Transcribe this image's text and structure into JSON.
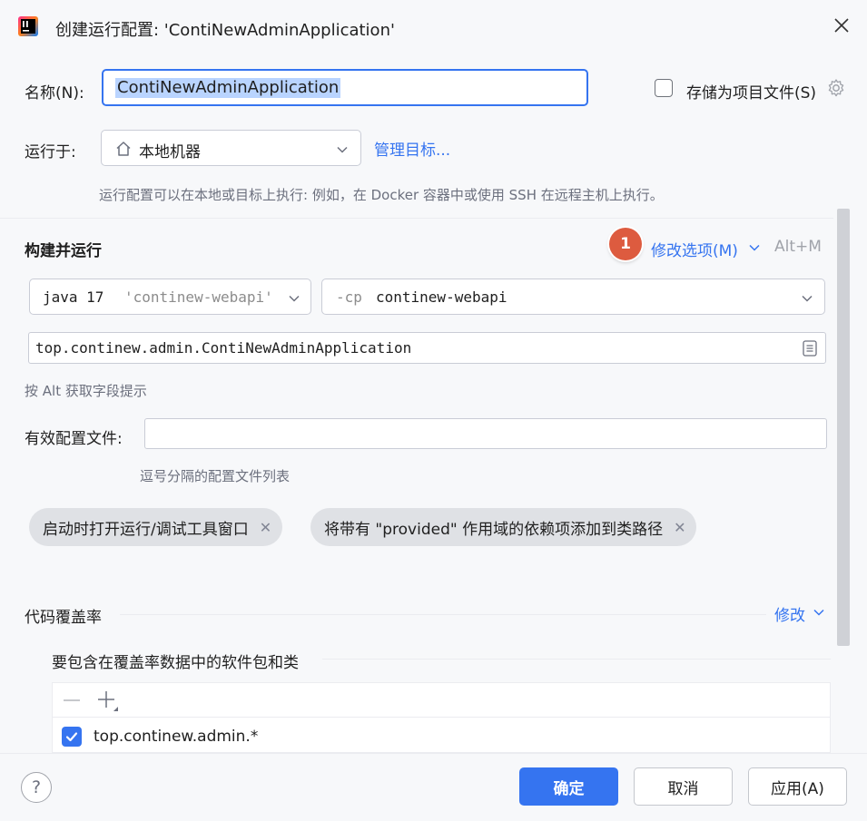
{
  "window": {
    "title": "创建运行配置: 'ContiNewAdminApplication'"
  },
  "form": {
    "name_label": "名称(N):",
    "name_value": "ContiNewAdminApplication",
    "store_as_project_label": "存储为项目文件(S)",
    "store_as_project_checked": false,
    "run_on_label": "运行于:",
    "run_on_value": "本地机器",
    "manage_targets_link": "管理目标...",
    "run_on_hint": "运行配置可以在本地或目标上执行: 例如，在 Docker 容器中或使用 SSH 在远程主机上执行。"
  },
  "build_run": {
    "section_title": "构建并运行",
    "badge_number": "1",
    "modify_options_label": "修改选项(M)",
    "modify_options_shortcut": "Alt+M",
    "jdk_version": "java 17",
    "jdk_module": "'continew-webapi'",
    "cp_flag": "-cp",
    "cp_module": "continew-webapi",
    "main_class": "top.continew.admin.ContiNewAdminApplication",
    "field_hint": "按 Alt 获取字段提示",
    "active_profiles_label": "有效配置文件:",
    "active_profiles_value": "",
    "active_profiles_hint": "逗号分隔的配置文件列表",
    "chips": [
      {
        "label": "启动时打开运行/调试工具窗口"
      },
      {
        "label": "将带有 \"provided\" 作用域的依赖项添加到类路径"
      }
    ]
  },
  "coverage": {
    "section_title": "代码覆盖率",
    "modify_label": "修改",
    "include_label": "要包含在覆盖率数据中的软件包和类",
    "items": [
      {
        "label": "top.continew.admin.*",
        "checked": true
      }
    ]
  },
  "buttons": {
    "ok": "确定",
    "cancel": "取消",
    "apply": "应用(A)",
    "help": "?"
  },
  "colors": {
    "accent": "#3574f0",
    "badge": "#dd5b3f",
    "background": "#f7f8fa"
  }
}
